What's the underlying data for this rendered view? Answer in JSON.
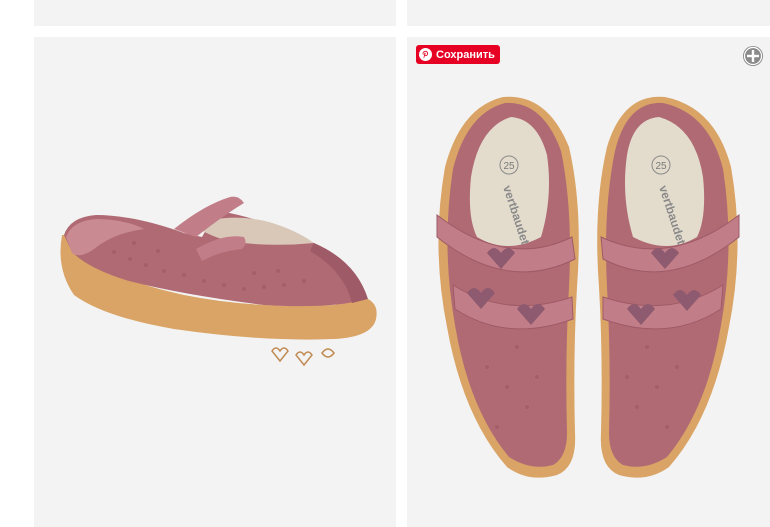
{
  "pinterest": {
    "save_label": "Сохранить"
  },
  "left_shoe": {
    "alt": "side view of pink shoe"
  },
  "right_shoes": {
    "size_label": "25",
    "brand_label": "vertbaudet"
  },
  "colors": {
    "tile_bg": "#f3f3f3",
    "pinterest_red": "#e60023",
    "shoe_pink": "#b06a74",
    "sole": "#d9a466"
  }
}
